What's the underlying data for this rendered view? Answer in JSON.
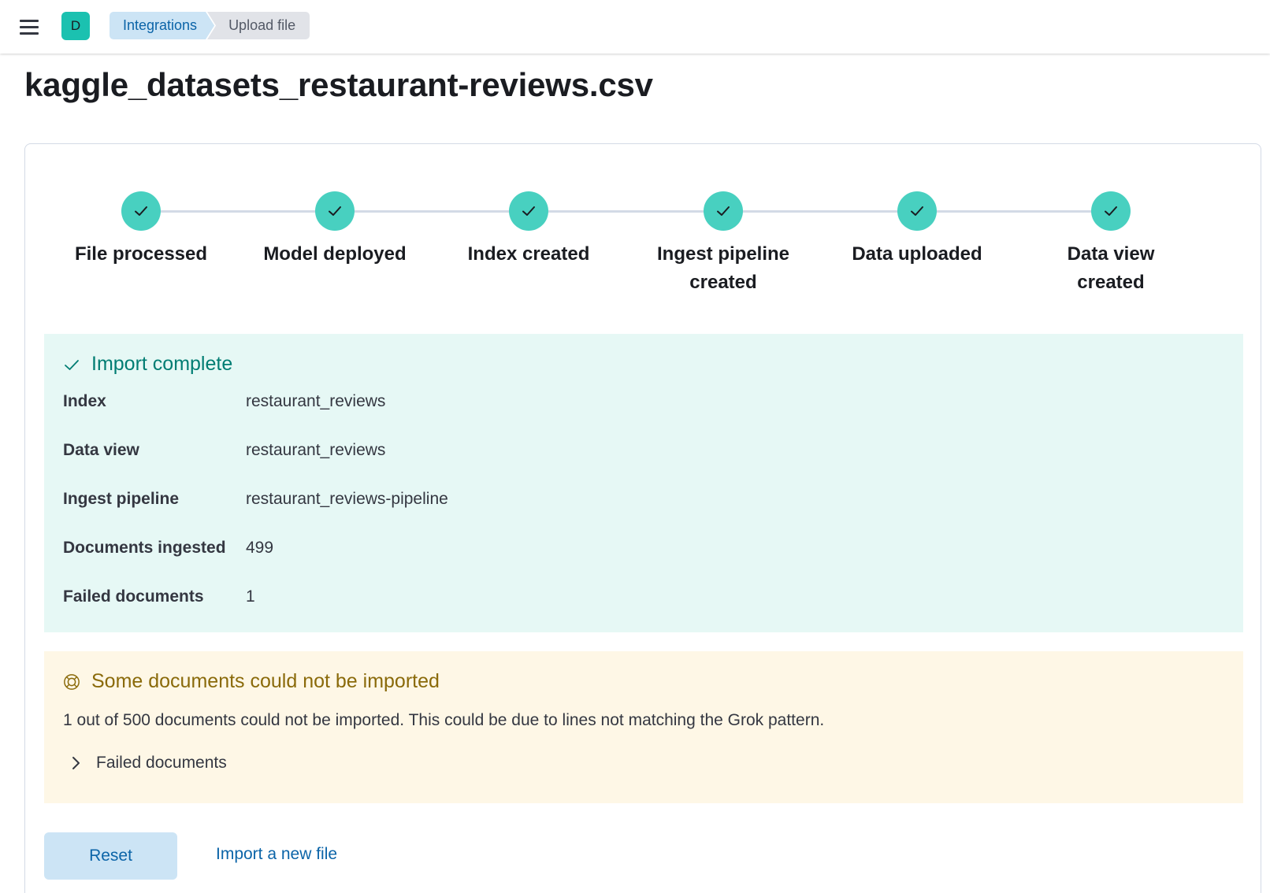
{
  "header": {
    "avatar_initial": "D",
    "breadcrumbs": [
      "Integrations",
      "Upload file"
    ]
  },
  "page": {
    "title": "kaggle_datasets_restaurant-reviews.csv"
  },
  "steps": [
    {
      "label": "File processed",
      "status": "complete"
    },
    {
      "label": "Model deployed",
      "status": "complete"
    },
    {
      "label": "Index created",
      "status": "complete"
    },
    {
      "label": "Ingest pipeline created",
      "status": "complete"
    },
    {
      "label": "Data uploaded",
      "status": "complete"
    },
    {
      "label": "Data view created",
      "status": "complete"
    }
  ],
  "import_complete": {
    "title": "Import complete",
    "rows": [
      {
        "key": "Index",
        "value": "restaurant_reviews"
      },
      {
        "key": "Data view",
        "value": "restaurant_reviews"
      },
      {
        "key": "Ingest pipeline",
        "value": "restaurant_reviews-pipeline"
      },
      {
        "key": "Documents ingested",
        "value": "499"
      },
      {
        "key": "Failed documents",
        "value": "1"
      }
    ]
  },
  "warning": {
    "title": "Some documents could not be imported",
    "body": "1 out of 500 documents could not be imported. This could be due to lines not matching the Grok pattern.",
    "accordion_label": "Failed documents"
  },
  "actions": {
    "reset_label": "Reset",
    "import_new_label": "Import a new file"
  },
  "colors": {
    "accent": "#0b64a8",
    "success": "#48d0c0",
    "success_bg": "#e6f8f5",
    "warning_bg": "#fef7e6",
    "warning_text": "#8a6a0a"
  }
}
